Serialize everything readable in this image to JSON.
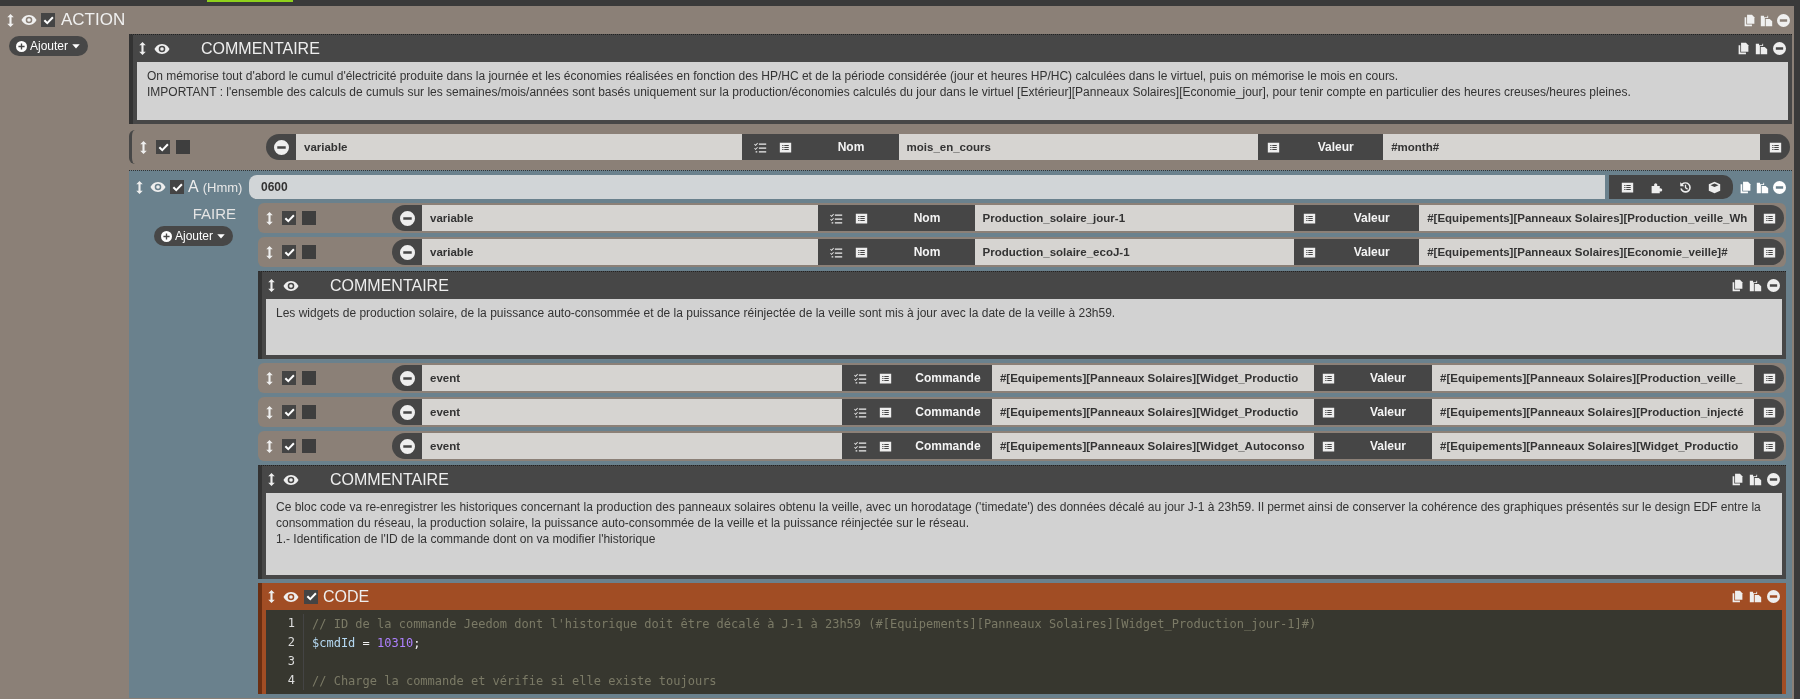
{
  "action": {
    "title": "ACTION",
    "enabled": true,
    "add_button": "Ajouter",
    "elements": [
      {
        "kind": "comment",
        "title": "COMMENTAIRE",
        "paragraphs": [
          "On mémorise tout d'abord le cumul d'électricité produite dans la journée et les économies réalisées en fonction des HP/HC et de la période considérée (jour et heures HP/HC) calculées dans le virtuel, puis on mémorise le mois en cours.",
          "IMPORTANT : l'ensemble des calculs de cumuls sur les semaines/mois/années sont basés uniquement sur la production/économies calculés du jour dans le virtuel [Extérieur][Panneaux Solaires][Economie_jour], pour tenir compte en particulier des heures creuses/heures pleines."
        ]
      },
      {
        "kind": "action",
        "enabled": true,
        "parallel": false,
        "action": "variable",
        "fields": [
          {
            "label": "Nom",
            "value": "mois_en_cours"
          },
          {
            "label": "Valeur",
            "value": "#month#"
          }
        ]
      },
      {
        "kind": "at",
        "enabled": true,
        "title": "A",
        "hint": "(Hmm)",
        "value": "0600",
        "section": "FAIRE",
        "add_button": "Ajouter",
        "elements": [
          {
            "kind": "action",
            "enabled": true,
            "parallel": false,
            "action": "variable",
            "fields": [
              {
                "label": "Nom",
                "value": "Production_solaire_jour-1"
              },
              {
                "label": "Valeur",
                "value": "#[Equipements][Panneaux Solaires][Production_veille_Wh"
              }
            ]
          },
          {
            "kind": "action",
            "enabled": true,
            "parallel": false,
            "action": "variable",
            "fields": [
              {
                "label": "Nom",
                "value": "Production_solaire_ecoJ-1"
              },
              {
                "label": "Valeur",
                "value": "#[Equipements][Panneaux Solaires][Economie_veille]#"
              }
            ]
          },
          {
            "kind": "comment",
            "title": "COMMENTAIRE",
            "paragraphs": [
              "Les widgets de production solaire, de la puissance auto-consommée et de la puissance réinjectée de la veille sont mis à jour avec la date de la veille à 23h59."
            ]
          },
          {
            "kind": "action",
            "enabled": true,
            "parallel": false,
            "action": "event",
            "fields": [
              {
                "label": "Commande",
                "value": "#[Equipements][Panneaux Solaires][Widget_Productio"
              },
              {
                "label": "Valeur",
                "value": "#[Equipements][Panneaux Solaires][Production_veille_"
              }
            ]
          },
          {
            "kind": "action",
            "enabled": true,
            "parallel": false,
            "action": "event",
            "fields": [
              {
                "label": "Commande",
                "value": "#[Equipements][Panneaux Solaires][Widget_Productio"
              },
              {
                "label": "Valeur",
                "value": "#[Equipements][Panneaux Solaires][Production_injecté"
              }
            ]
          },
          {
            "kind": "action",
            "enabled": true,
            "parallel": false,
            "action": "event",
            "fields": [
              {
                "label": "Commande",
                "value": "#[Equipements][Panneaux Solaires][Widget_Autoconso"
              },
              {
                "label": "Valeur",
                "value": "#[Equipements][Panneaux Solaires][Widget_Productio"
              }
            ]
          },
          {
            "kind": "comment",
            "title": "COMMENTAIRE",
            "paragraphs": [
              "Ce bloc code va re-enregistrer les historiques concernant la production des panneaux solaires obtenu la veille, avec un horodatage ('timedate') des données décalé au jour J-1 à 23h59. Il permet ainsi de conserver la cohérence des graphiques présentés sur le design EDF entre la consommation du réseau, la production solaire, la puissance auto-consommée de la veille et la puissance réinjectée sur le réseau.",
              "1.- Identification de l'ID de la commande dont on va modifier l'historique"
            ]
          },
          {
            "kind": "code",
            "enabled": true,
            "title": "CODE",
            "lines": [
              {
                "number": "1",
                "tokens": [
                  {
                    "kind": "comment",
                    "text": "// ID de la commande Jeedom dont l'historique doit être décalé à J-1 à 23h59 (#[Equipements][Panneaux Solaires][Widget_Production_jour-1]#)"
                  }
                ]
              },
              {
                "number": "2",
                "tokens": [
                  {
                    "kind": "variable",
                    "text": "$cmdId"
                  },
                  {
                    "kind": "plain",
                    "text": " = "
                  },
                  {
                    "kind": "number",
                    "text": "10310"
                  },
                  {
                    "kind": "plain",
                    "text": ";"
                  }
                ]
              },
              {
                "number": "3"
              },
              {
                "number": "4",
                "tokens": [
                  {
                    "kind": "comment",
                    "text": "// Charge la commande et vérifie si elle existe toujours"
                  }
                ]
              }
            ]
          }
        ]
      }
    ]
  }
}
